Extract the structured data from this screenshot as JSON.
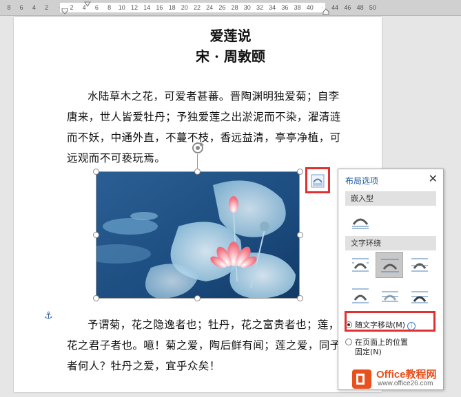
{
  "ruler": {
    "ticks": [
      "8",
      "6",
      "4",
      "2",
      "",
      "2",
      "4",
      "6",
      "8",
      "10",
      "12",
      "14",
      "16",
      "18",
      "20",
      "22",
      "24",
      "26",
      "28",
      "30",
      "32",
      "34",
      "36",
      "38",
      "40",
      "",
      "44",
      "46",
      "48",
      "50"
    ]
  },
  "document": {
    "title": "爱莲说",
    "author": "宋 · 周敦颐",
    "paragraph1": [
      "水陆草木之花，可爱者甚蕃。晋陶渊明独爱菊；自李",
      "唐来，世人皆爱牡丹；予独爱莲之出淤泥而不染，濯清涟",
      "而不妖，中通外直，不蔓不枝，香远益清，亭亭净植，可",
      "远观而不可亵玩焉。"
    ],
    "paragraph2": [
      "予谓菊，花之隐逸者也；牡丹，花之富贵者也；莲，",
      "花之君子者也。噫！菊之爱，陶后鲜有闻；莲之爱，同予",
      "者何人？牡丹之爱，宜乎众矣！"
    ]
  },
  "panel": {
    "title": "布局选项",
    "close": "✕",
    "section_inline": "嵌入型",
    "section_wrap": "文字环绕",
    "radio1_label": "随文字移动(M)",
    "radio2_label_line1": "在页面上的位置",
    "radio2_label_line2": "固定(N)"
  },
  "watermark": {
    "brand": "Office教程网",
    "url": "www.office26.com"
  },
  "colors": {
    "accent": "#1e5a9e",
    "highlight": "#e03030",
    "brand_orange": "#e8501c"
  }
}
